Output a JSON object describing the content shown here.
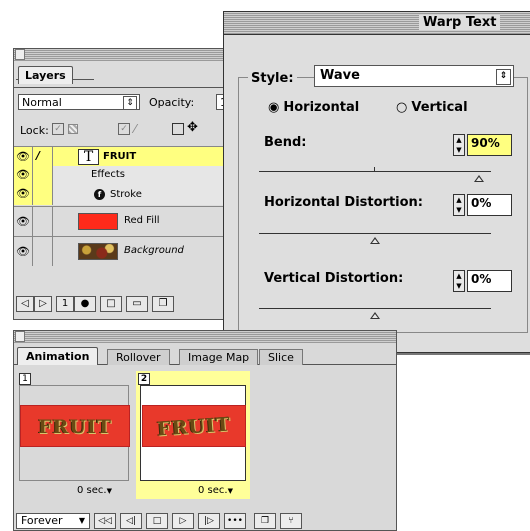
{
  "layers_palette": {
    "tab_label": "Layers",
    "blend_mode": "Normal",
    "opacity_label": "Opacity:",
    "opacity_value": "1",
    "lock_label": "Lock:",
    "layers": [
      {
        "name": "FRUIT",
        "type": "text",
        "selected": true,
        "visible": true
      },
      {
        "name": "Effects",
        "type": "effects-group"
      },
      {
        "name": "Stroke",
        "type": "effect"
      },
      {
        "name": "Red Fill",
        "type": "shape",
        "color": "#ff2a1a",
        "visible": true
      },
      {
        "name": "Background",
        "type": "image",
        "visible": true
      }
    ],
    "text_layer_glyph": "T",
    "selected_row_color": "#ffff80"
  },
  "warp_dialog": {
    "title": "Warp Text",
    "style_label": "Style:",
    "style_value": "Wave",
    "orientation": {
      "horizontal_label": "Horizontal",
      "vertical_label": "Vertical",
      "selected": "Horizontal"
    },
    "bend_label": "Bend:",
    "bend_value": "90%",
    "h_distortion_label": "Horizontal Distortion:",
    "h_distortion_value": "0%",
    "v_distortion_label": "Vertical Distortion:",
    "v_distortion_value": "0%",
    "sliders": {
      "bend": 0.95,
      "h_distortion": 0.5,
      "v_distortion": 0.5
    }
  },
  "animation_palette": {
    "tabs": [
      "Animation",
      "Rollover",
      "Image Map",
      "Slice"
    ],
    "frames": [
      {
        "number": "1",
        "delay": "0 sec.",
        "text": "FRUIT",
        "selected": false
      },
      {
        "number": "2",
        "delay": "0 sec.",
        "text": "FRUIT",
        "selected": true
      }
    ],
    "loop_value": "Forever",
    "selected_frame_color": "#ffff99"
  }
}
